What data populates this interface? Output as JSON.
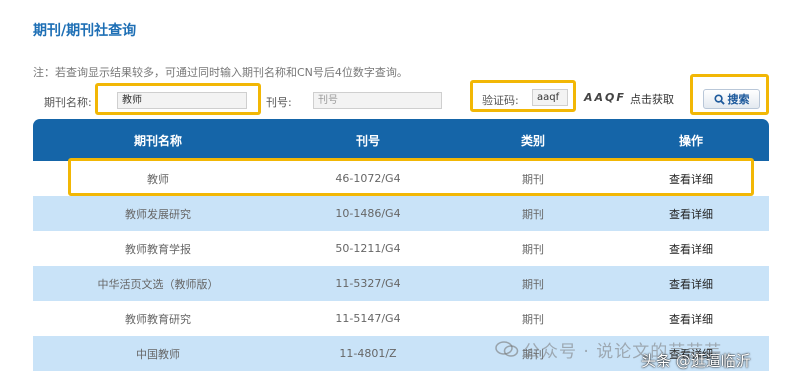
{
  "page_title": "期刊/期刊社查询",
  "note": "注：若查询显示结果较多，可通过同时输入期刊名称和CN号后4位数字查询。",
  "search": {
    "journal_name_label": "期刊名称:",
    "journal_name_value": "教师",
    "issn_label": "刊号:",
    "issn_placeholder": "刊号",
    "captcha_label": "验证码:",
    "captcha_value": "aaqf",
    "captcha_image_text": "AAQF",
    "refresh_label": "点击获取",
    "search_button_label": "搜索",
    "search_icon": "search-icon"
  },
  "table": {
    "headers": [
      "期刊名称",
      "刊号",
      "类别",
      "操作"
    ],
    "rows": [
      {
        "name": "教师",
        "cn": "46-1072/G4",
        "category": "期刊",
        "action": "查看详细"
      },
      {
        "name": "教师发展研究",
        "cn": "10-1486/G4",
        "category": "期刊",
        "action": "查看详细"
      },
      {
        "name": "教师教育学报",
        "cn": "50-1211/G4",
        "category": "期刊",
        "action": "查看详细"
      },
      {
        "name": "中华活页文选（教师版）",
        "cn": "11-5327/G4",
        "category": "期刊",
        "action": "查看详细"
      },
      {
        "name": "教师教育研究",
        "cn": "11-5147/G4",
        "category": "期刊",
        "action": "查看详细"
      },
      {
        "name": "中国教师",
        "cn": "11-4801/Z",
        "category": "期刊",
        "action": "查看详细"
      }
    ]
  },
  "watermark": {
    "text1": "公众号 · 说论文的芸芸芸",
    "text2": "头条 @逛逼临沂"
  },
  "colors": {
    "accent": "#1565a8",
    "row_alt": "#c9e3f8",
    "highlight": "#f2b705"
  }
}
